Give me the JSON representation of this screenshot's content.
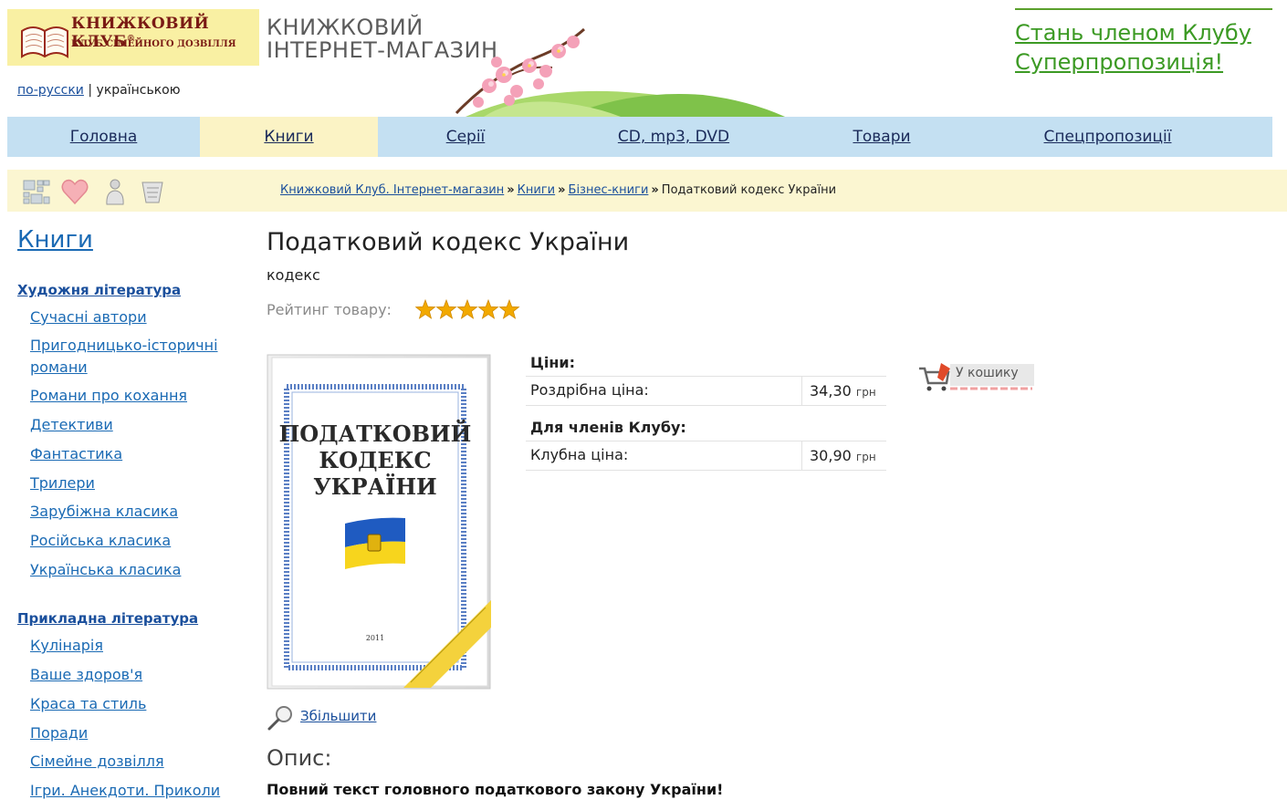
{
  "header": {
    "logo_title": "КНИЖКОВИЙ КЛУБ",
    "logo_reg": "®",
    "logo_subtitle": "КЛУБ СІМЕЙНОГО ДОЗВІЛЛЯ",
    "shop_title_line1": "КНИЖКОВИЙ",
    "shop_title_line2": "ІНТЕРНЕТ-МАГАЗИН",
    "lang_ru": "по-русски",
    "lang_sep": "|",
    "lang_ua": "українською",
    "promo_line1": "Стань членом Клубу",
    "promo_line2": "Суперпропозиція!"
  },
  "nav": {
    "items": [
      {
        "label": "Головна"
      },
      {
        "label": "Книги"
      },
      {
        "label": "Серії"
      },
      {
        "label": "CD, mp3, DVD"
      },
      {
        "label": "Товари"
      },
      {
        "label": "Спецпропозиції"
      }
    ]
  },
  "toolbar": {
    "icons": [
      "grid-icon",
      "heart-icon",
      "user-icon",
      "cart-list-icon"
    ]
  },
  "breadcrumb": {
    "items": [
      "Книжковий Клуб. Інтернет-магазин",
      "Книги",
      "Бізнес-книги"
    ],
    "current": "Податковий кодекс України",
    "separator": "»"
  },
  "sidebar": {
    "title": "Книги",
    "group1": {
      "title": "Художня література",
      "items": [
        "Сучасні автори",
        "Пригодницько-історичні романи",
        "Романи про кохання",
        "Детективи",
        "Фантастика",
        "Трилери",
        "Зарубіжна класика",
        "Російська класика",
        "Українська класика"
      ]
    },
    "group2": {
      "title": "Прикладна література",
      "items": [
        "Кулінарія",
        "Ваше здоров'я",
        "Краса та стиль",
        "Поради",
        "Сімейне дозвілля",
        "Ігри. Анекдоти. Приколи"
      ]
    }
  },
  "product": {
    "title": "Податковий кодекс України",
    "type": "кодекс",
    "rating_label": "Рейтинг товару:",
    "rating": 5,
    "cover": {
      "line1": "ПОДАТКОВИЙ",
      "line2": "КОДЕКС",
      "line3": "УКРАЇНИ",
      "year": "2011"
    },
    "zoom_label": "Збільшити",
    "prices_label": "Ціни:",
    "retail_label": "Роздрібна ціна:",
    "retail_price": "34,30",
    "members_label": "Для членів Клубу:",
    "club_label": "Клубна ціна:",
    "club_price": "30,90",
    "currency": "грн",
    "cart_label": "У кошику",
    "description_title": "Опис:",
    "description_text": "Повний текст головного податкового закону України!"
  },
  "colors": {
    "nav_bg": "#c4e0f2",
    "nav_active": "#fbf3c5",
    "strip_bg": "#fbf6d1",
    "logo_bg": "#f9f0a3",
    "link": "#1a4f9c",
    "promo": "#3c9a24",
    "star": "#f2a900"
  }
}
